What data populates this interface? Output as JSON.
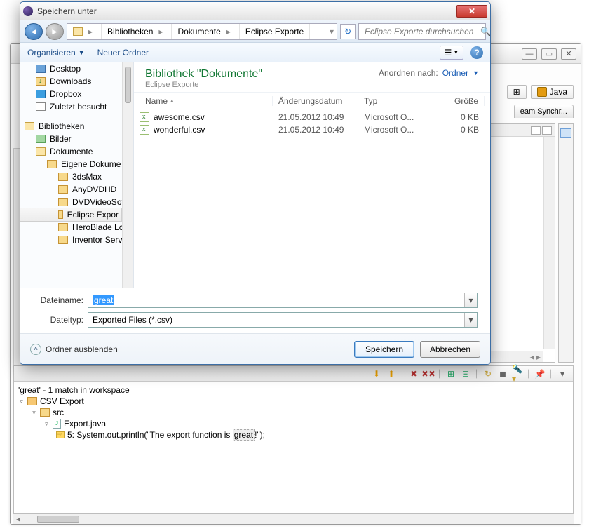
{
  "dialog": {
    "title": "Speichern unter",
    "breadcrumbs": [
      "Bibliotheken",
      "Dokumente",
      "Eclipse Exporte"
    ],
    "search_placeholder": "Eclipse Exporte durchsuchen",
    "toolbar": {
      "organize": "Organisieren",
      "new_folder": "Neuer Ordner"
    },
    "nav_tree": {
      "quick": [
        {
          "icon": "desktop",
          "label": "Desktop"
        },
        {
          "icon": "downloads",
          "label": "Downloads"
        },
        {
          "icon": "dropbox",
          "label": "Dropbox"
        },
        {
          "icon": "recent",
          "label": "Zuletzt besucht"
        }
      ],
      "libraries_label": "Bibliotheken",
      "libs": [
        {
          "icon": "pictures",
          "label": "Bilder",
          "lv": 1
        },
        {
          "icon": "library",
          "label": "Dokumente",
          "lv": 1
        },
        {
          "icon": "folder",
          "label": "Eigene Dokume",
          "lv": 2
        },
        {
          "icon": "folder",
          "label": "3dsMax",
          "lv": 3
        },
        {
          "icon": "folder",
          "label": "AnyDVDHD",
          "lv": 3
        },
        {
          "icon": "folder",
          "label": "DVDVideoSof",
          "lv": 3
        },
        {
          "icon": "folder",
          "label": "Eclipse Expor",
          "lv": 3,
          "selected": true
        },
        {
          "icon": "folder",
          "label": "HeroBlade Lc",
          "lv": 3
        },
        {
          "icon": "folder",
          "label": "Inventor Serv",
          "lv": 3
        }
      ]
    },
    "pane": {
      "title": "Bibliothek \"Dokumente\"",
      "subtitle": "Eclipse Exporte",
      "arrange_label": "Anordnen nach:",
      "arrange_value": "Ordner",
      "columns": {
        "name": "Name",
        "date": "Änderungsdatum",
        "type": "Typ",
        "size": "Größe"
      },
      "rows": [
        {
          "name": "awesome.csv",
          "date": "21.05.2012 10:49",
          "type": "Microsoft O...",
          "size": "0 KB"
        },
        {
          "name": "wonderful.csv",
          "date": "21.05.2012 10:49",
          "type": "Microsoft O...",
          "size": "0 KB"
        }
      ]
    },
    "filename_label": "Dateiname:",
    "filename_value": "great",
    "filetype_label": "Dateityp:",
    "filetype_value": "Exported Files (*.csv)",
    "hide_folders": "Ordner ausblenden",
    "save": "Speichern",
    "cancel": "Abbrechen"
  },
  "eclipse": {
    "perspective": "Java",
    "tab": "eam Synchr...",
    "search": {
      "header": "'great' - 1 match in workspace",
      "project": "CSV Export",
      "folder": "src",
      "file": "Export.java",
      "match_prefix": "5: System.out.println(\"The export function is ",
      "match_word": "great",
      "match_suffix": "!\");"
    }
  }
}
